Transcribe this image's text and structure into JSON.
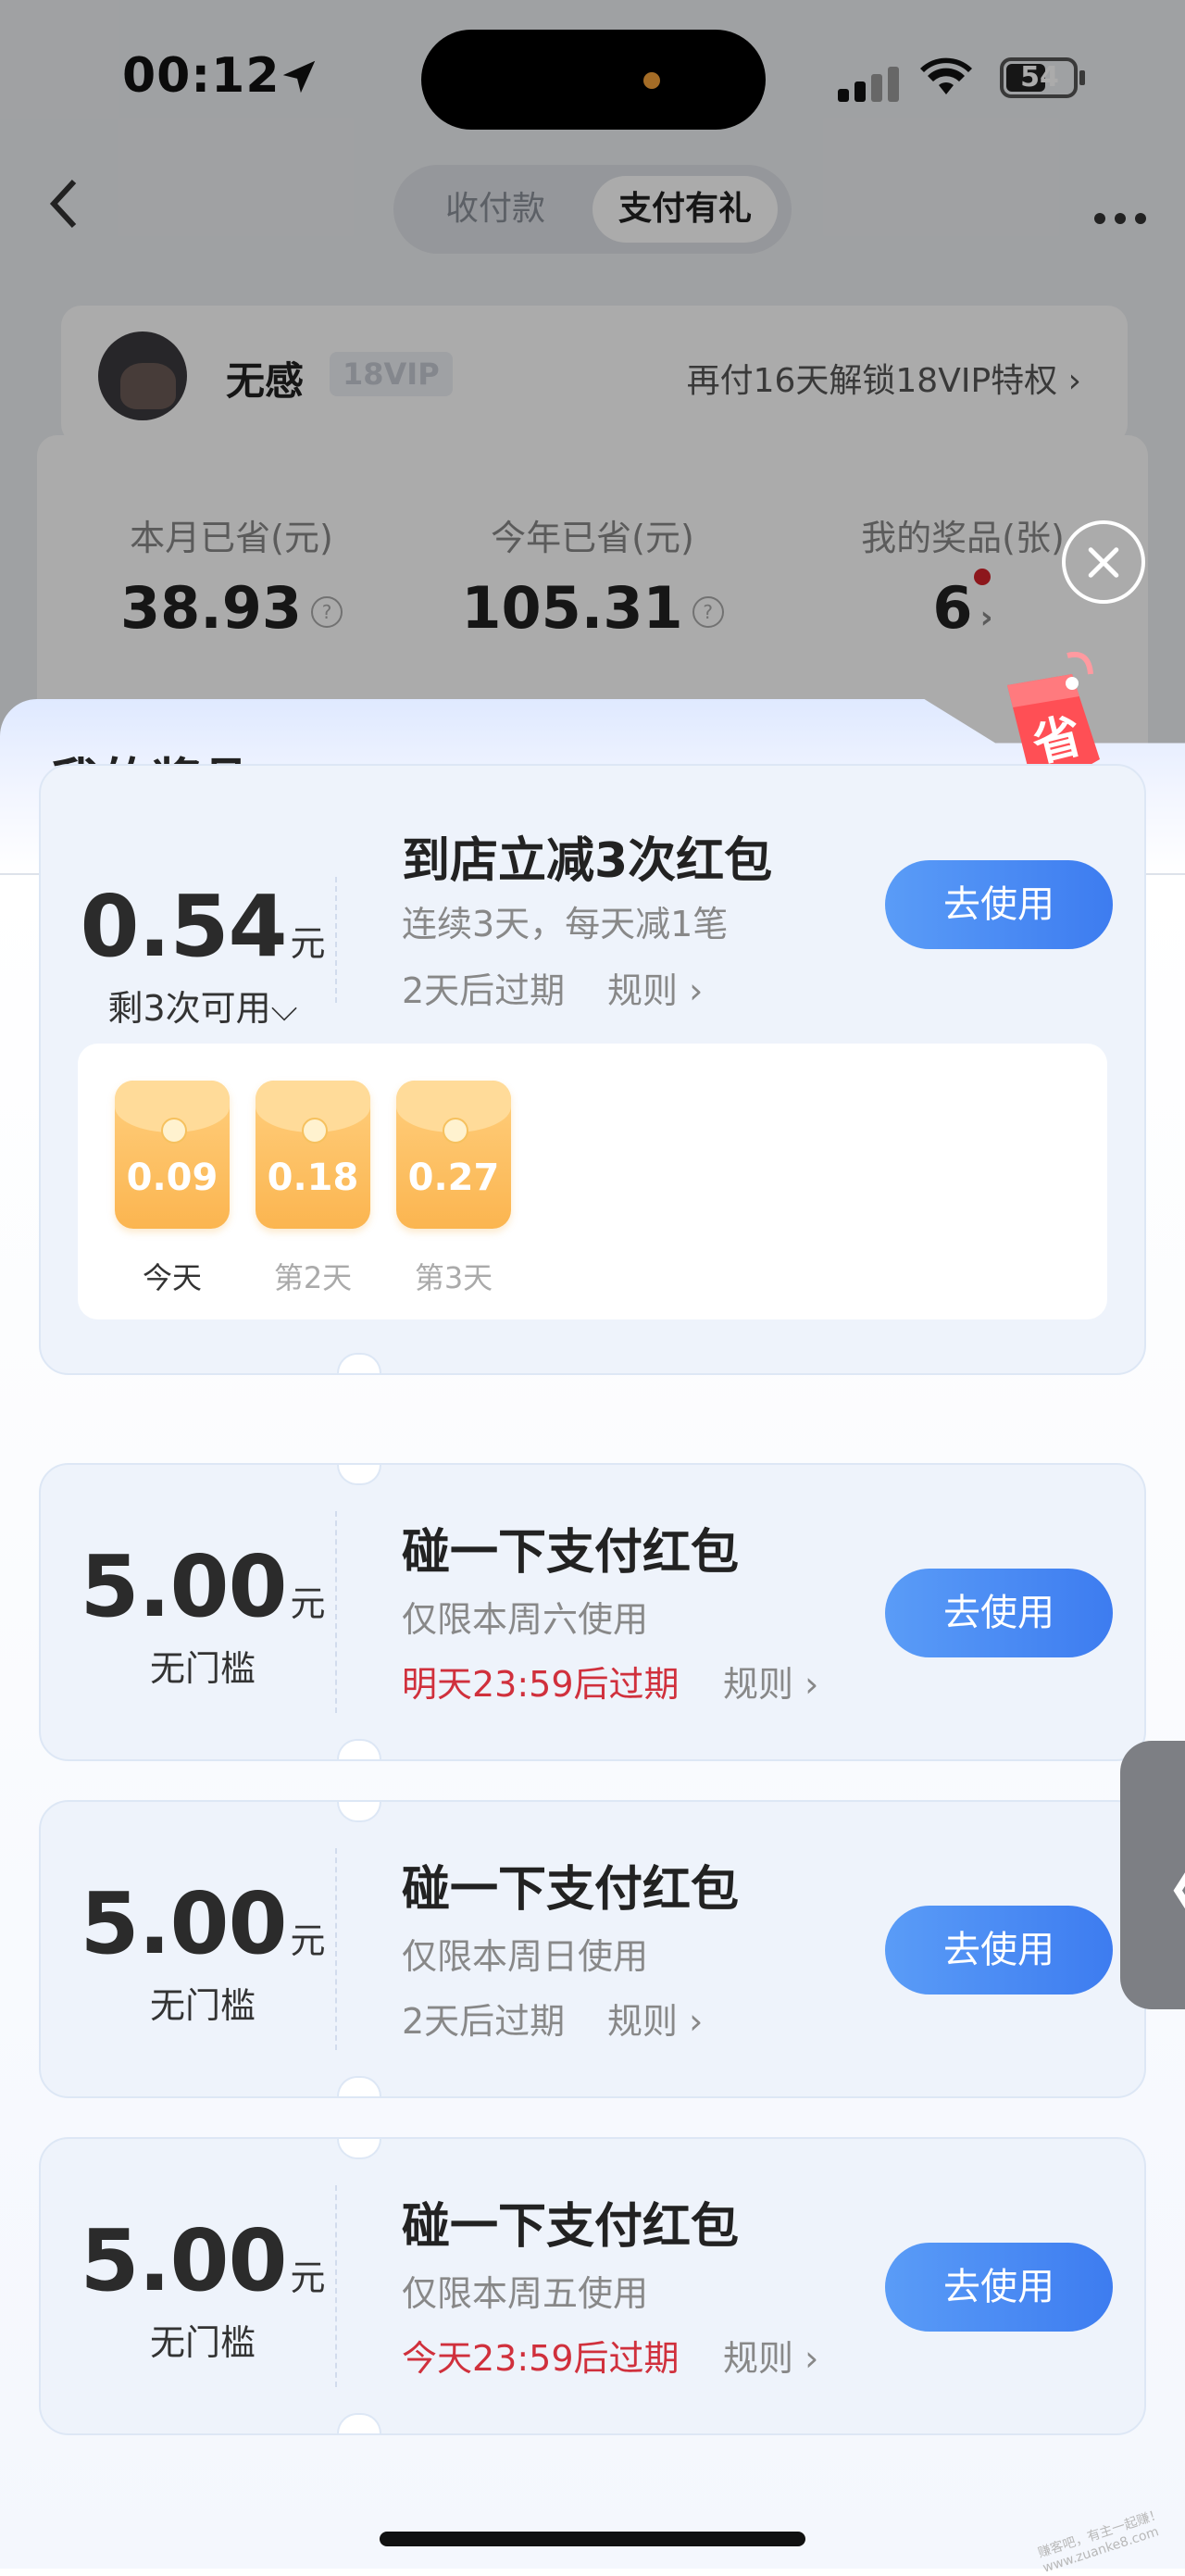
{
  "status_bar": {
    "time": "00:12",
    "battery": "54"
  },
  "header": {
    "tabs": [
      "收付款",
      "支付有礼"
    ],
    "active_tab": 1
  },
  "user": {
    "name": "无感",
    "vip_badge": "18VIP",
    "unlock_text": "再付16天解锁18VIP特权 ›"
  },
  "stats": [
    {
      "label": "本月已省(元)",
      "value": "38.93"
    },
    {
      "label": "今年已省(元)",
      "value": "105.31"
    },
    {
      "label": "我的奖品(张)",
      "value": "6"
    }
  ],
  "sheet": {
    "title": "我的奖品",
    "tag_char": "省"
  },
  "cards": [
    {
      "amount": "0.54",
      "unit": "元",
      "sub": "剩3次可用⌵",
      "title": "到店立减3次红包",
      "desc": "连续3天，每天减1笔",
      "expiry": "2天后过期",
      "expiry_color": "gray",
      "rule": "规则 ›",
      "button": "去使用",
      "days": [
        {
          "value": "0.09",
          "label": "今天"
        },
        {
          "value": "0.18",
          "label": "第2天"
        },
        {
          "value": "0.27",
          "label": "第3天"
        }
      ]
    },
    {
      "amount": "5.00",
      "unit": "元",
      "sub": "无门槛",
      "title": "碰一下支付红包",
      "desc": "仅限本周六使用",
      "expiry": "明天23:59后过期",
      "expiry_color": "red",
      "rule": "规则 ›",
      "button": "去使用"
    },
    {
      "amount": "5.00",
      "unit": "元",
      "sub": "无门槛",
      "title": "碰一下支付红包",
      "desc": "仅限本周日使用",
      "expiry": "2天后过期",
      "expiry_color": "gray",
      "rule": "规则 ›",
      "button": "去使用"
    },
    {
      "amount": "5.00",
      "unit": "元",
      "sub": "无门槛",
      "title": "碰一下支付红包",
      "desc": "仅限本周五使用",
      "expiry": "今天23:59后过期",
      "expiry_color": "red",
      "rule": "规则 ›",
      "button": "去使用"
    }
  ],
  "side_tab": "〈",
  "watermark": "赚客吧，有主一起赚！ www.zuanke8.com"
}
